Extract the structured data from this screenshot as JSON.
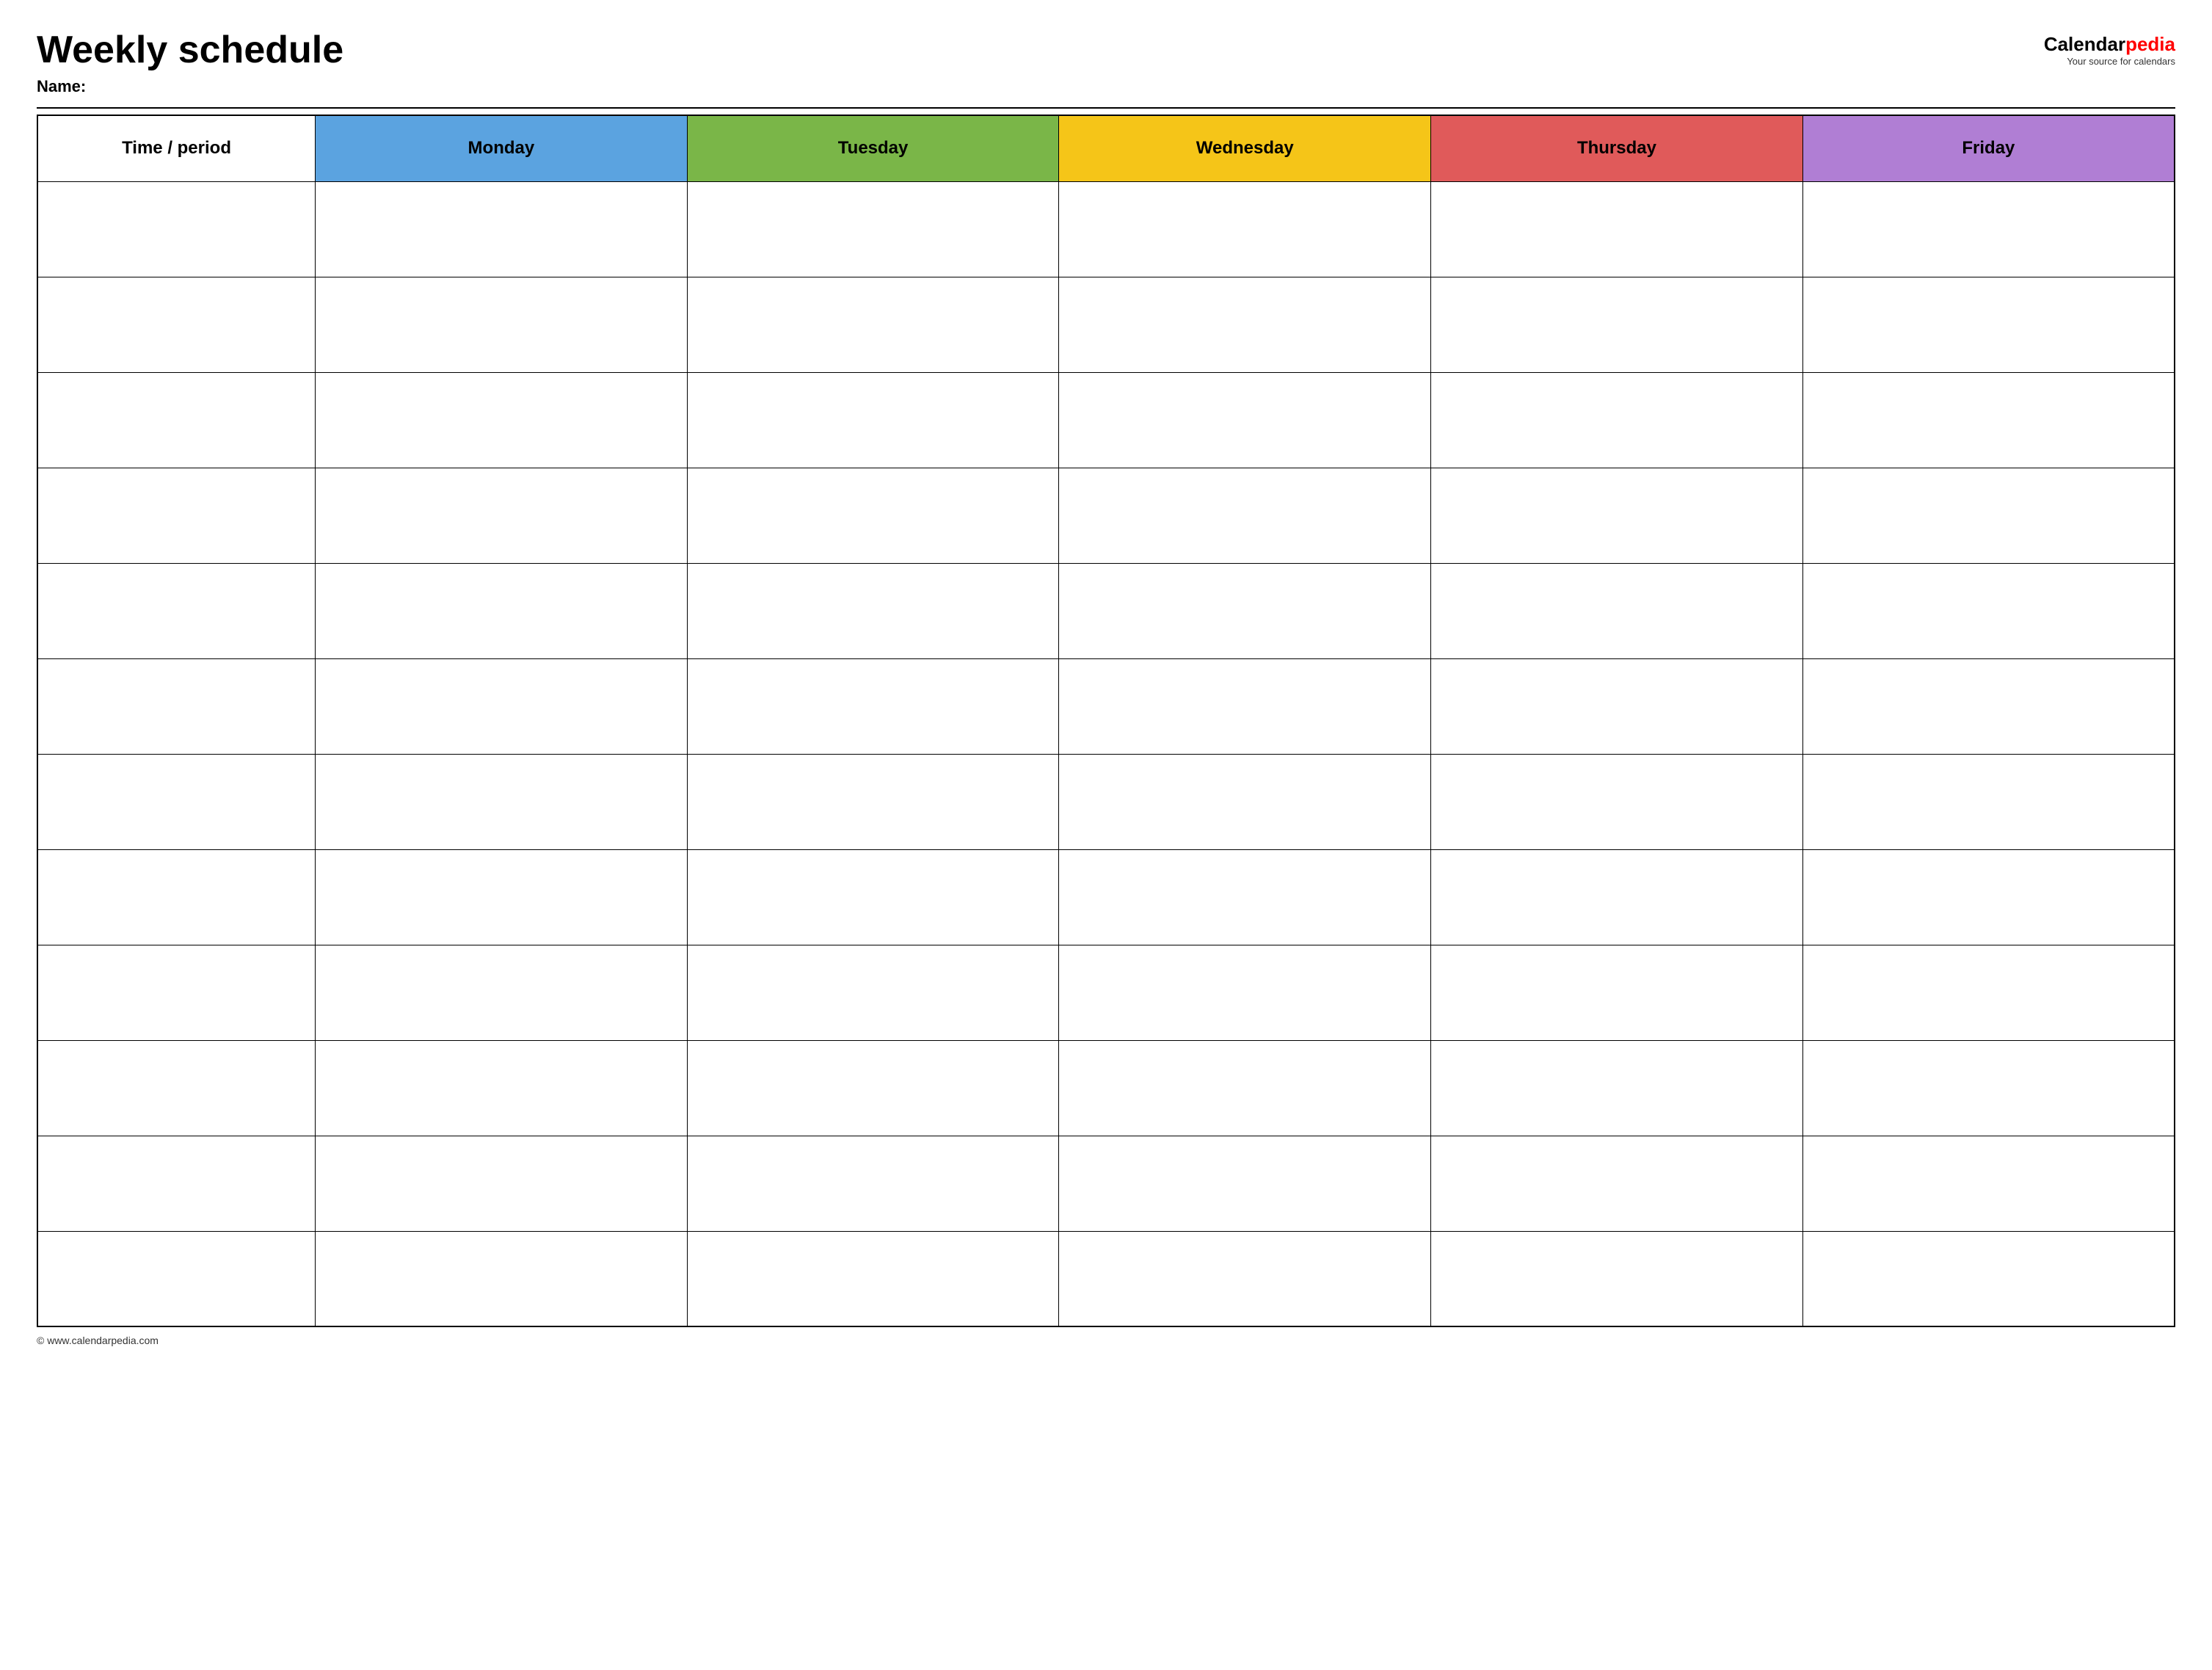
{
  "header": {
    "title": "Weekly schedule",
    "name_label": "Name:",
    "logo_calendar": "Calendar",
    "logo_pedia": "pedia",
    "logo_tagline": "Your source for calendars"
  },
  "table": {
    "columns": [
      {
        "key": "time",
        "label": "Time / period",
        "color": "#ffffff"
      },
      {
        "key": "monday",
        "label": "Monday",
        "color": "#5ba3e0"
      },
      {
        "key": "tuesday",
        "label": "Tuesday",
        "color": "#7ab648"
      },
      {
        "key": "wednesday",
        "label": "Wednesday",
        "color": "#f5c518"
      },
      {
        "key": "thursday",
        "label": "Thursday",
        "color": "#e05a5a"
      },
      {
        "key": "friday",
        "label": "Friday",
        "color": "#b07ed4"
      }
    ],
    "rows": [
      [
        "",
        "",
        "",
        "",
        "",
        ""
      ],
      [
        "",
        "",
        "",
        "",
        "",
        ""
      ],
      [
        "",
        "",
        "",
        "",
        "",
        ""
      ],
      [
        "",
        "",
        "",
        "",
        "",
        ""
      ],
      [
        "",
        "",
        "",
        "",
        "",
        ""
      ],
      [
        "",
        "",
        "",
        "",
        "",
        ""
      ],
      [
        "",
        "",
        "",
        "",
        "",
        ""
      ],
      [
        "",
        "",
        "",
        "",
        "",
        ""
      ],
      [
        "",
        "",
        "",
        "",
        "",
        ""
      ],
      [
        "",
        "",
        "",
        "",
        "",
        ""
      ],
      [
        "",
        "",
        "",
        "",
        "",
        ""
      ],
      [
        "",
        "",
        "",
        "",
        "",
        ""
      ]
    ]
  },
  "footer": {
    "copyright": "© www.calendarpedia.com"
  }
}
